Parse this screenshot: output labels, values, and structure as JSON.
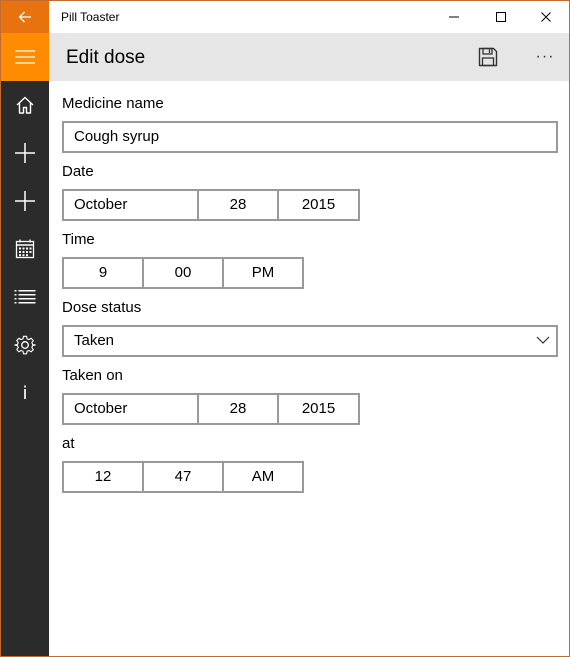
{
  "app": {
    "title": "Pill Toaster"
  },
  "window_controls": {
    "minimize": "minimize-icon",
    "maximize": "maximize-icon",
    "close": "close-icon"
  },
  "nav": {
    "back_icon": "back-arrow-icon",
    "menu_icon": "hamburger-icon",
    "items": [
      {
        "icon": "home-icon"
      },
      {
        "icon": "add-icon"
      },
      {
        "icon": "add-icon"
      },
      {
        "icon": "calendar-icon"
      },
      {
        "icon": "list-icon"
      },
      {
        "icon": "gear-icon"
      },
      {
        "icon": "info-icon",
        "glyph": "i"
      }
    ],
    "accent": "#e8720e",
    "menu_accent": "#ff8c00",
    "rail_color": "#2b2b2b"
  },
  "header": {
    "title": "Edit dose",
    "save_icon": "save-icon",
    "more_label": "···"
  },
  "form": {
    "medicine_label": "Medicine name",
    "medicine_value": "Cough syrup",
    "date_label": "Date",
    "date": {
      "month": "October",
      "day": "28",
      "year": "2015"
    },
    "time_label": "Time",
    "time": {
      "hour": "9",
      "minute": "00",
      "period": "PM"
    },
    "status_label": "Dose status",
    "status_value": "Taken",
    "taken_on_label": "Taken on",
    "taken_on": {
      "month": "October",
      "day": "28",
      "year": "2015"
    },
    "at_label": "at",
    "at_time": {
      "hour": "12",
      "minute": "47",
      "period": "AM"
    }
  }
}
